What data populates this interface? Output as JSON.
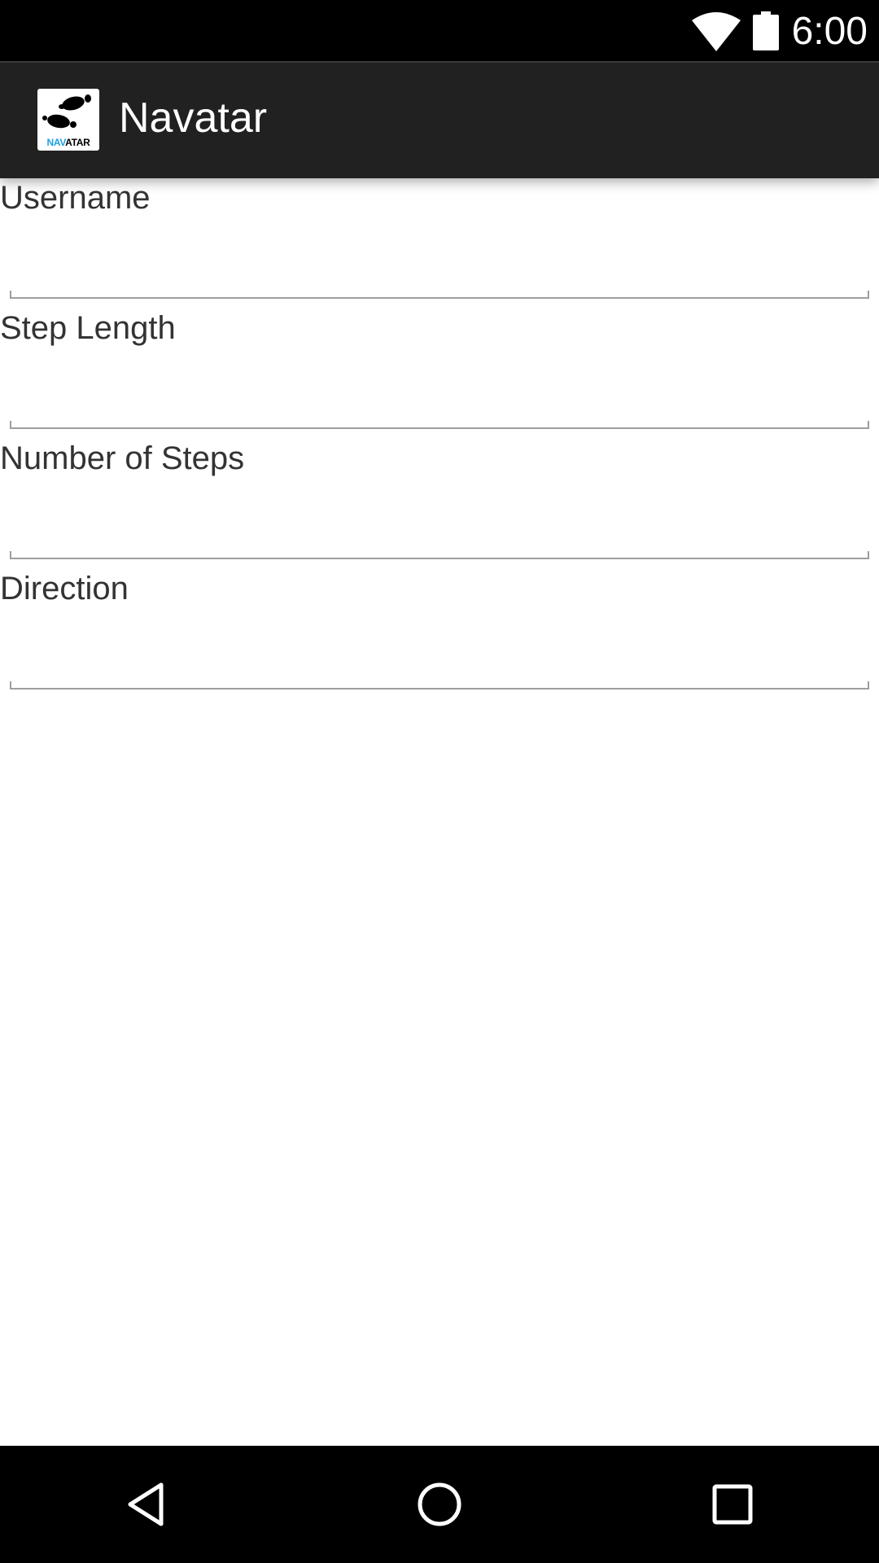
{
  "status_bar": {
    "time": "6:00",
    "icons": [
      "wifi-icon",
      "battery-icon"
    ]
  },
  "action_bar": {
    "title": "Navatar",
    "logo": {
      "icon": "footprints-logo-icon",
      "text_nav": "NAV",
      "text_atar": "ATAR"
    }
  },
  "form": {
    "fields": [
      {
        "label": "Username",
        "value": "",
        "placeholder": ""
      },
      {
        "label": "Step Length",
        "value": "",
        "placeholder": ""
      },
      {
        "label": "Number of Steps",
        "value": "",
        "placeholder": ""
      },
      {
        "label": "Direction",
        "value": "",
        "placeholder": ""
      }
    ]
  },
  "nav_bar": {
    "buttons": [
      "back-icon",
      "home-icon",
      "recents-icon"
    ]
  },
  "colors": {
    "status_bar": "#000000",
    "action_bar": "#212121",
    "background": "#ffffff",
    "logo_accent": "#1ea0dc",
    "input_underline": "#9e9e9e"
  }
}
